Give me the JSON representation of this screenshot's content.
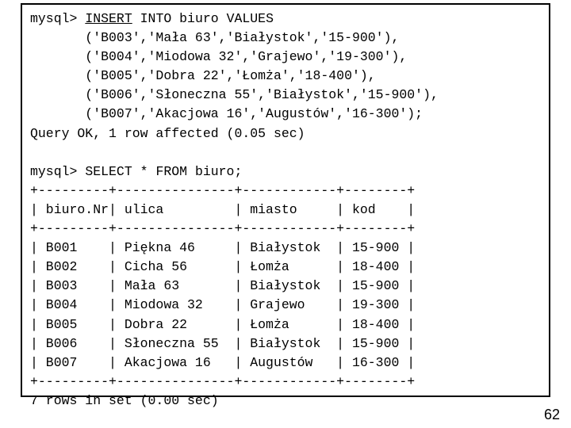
{
  "terminal": {
    "prompt": "mysql>",
    "insert_cmd": {
      "kw_insert": "INSERT",
      "rest": " INTO biuro VALUES",
      "rows": [
        "       ('B003','Mała 63','Białystok','15-900'),",
        "       ('B004','Miodowa 32','Grajewo','19-300'),",
        "       ('B005','Dobra 22','Łomża','18-400'),",
        "       ('B006','Słoneczna 55','Białystok','15-900'),",
        "       ('B007','Akacjowa 16','Augustów','16-300');"
      ],
      "result": "Query OK, 1 row affected (0.05 sec)"
    },
    "select_cmd": {
      "line": "SELECT * FROM biuro;",
      "border": "+---------+---------------+------------+--------+",
      "header": "| biuro.Nr| ulica         | miasto     | kod    |",
      "rows": [
        "| B001    | Piękna 46     | Białystok  | 15-900 |",
        "| B002    | Cicha 56      | Łomża      | 18-400 |",
        "| B003    | Mała 63       | Białystok  | 15-900 |",
        "| B004    | Miodowa 32    | Grajewo    | 19-300 |",
        "| B005    | Dobra 22      | Łomża      | 18-400 |",
        "| B006    | Słoneczna 55  | Białystok  | 15-900 |",
        "| B007    | Akacjowa 16   | Augustów   | 16-300 |"
      ],
      "footer": "7 rows in set (0.00 sec)"
    }
  },
  "chart_data": {
    "type": "table",
    "title": "biuro",
    "columns": [
      "biuro.Nr",
      "ulica",
      "miasto",
      "kod"
    ],
    "rows": [
      [
        "B001",
        "Piękna 46",
        "Białystok",
        "15-900"
      ],
      [
        "B002",
        "Cicha 56",
        "Łomża",
        "18-400"
      ],
      [
        "B003",
        "Mała 63",
        "Białystok",
        "15-900"
      ],
      [
        "B004",
        "Miodowa 32",
        "Grajewo",
        "19-300"
      ],
      [
        "B005",
        "Dobra 22",
        "Łomża",
        "18-400"
      ],
      [
        "B006",
        "Słoneczna 55",
        "Białystok",
        "15-900"
      ],
      [
        "B007",
        "Akacjowa 16",
        "Augustów",
        "16-300"
      ]
    ]
  },
  "slide_number": "62"
}
